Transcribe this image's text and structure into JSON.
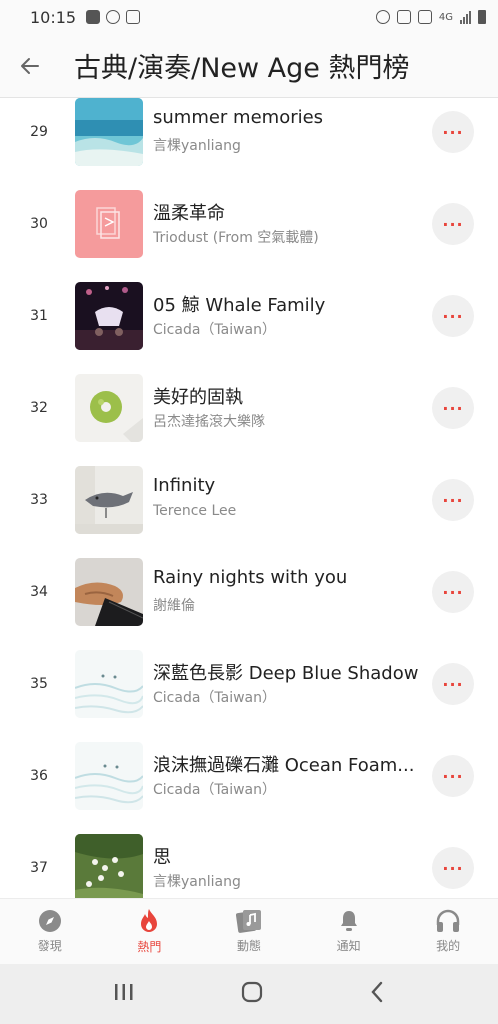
{
  "status_bar": {
    "time": "10:15",
    "network": "4G",
    "icons": [
      "calendar-icon",
      "do-not-disturb-icon",
      "image-icon",
      "alarm-icon",
      "mute-icon",
      "battery-saver-icon",
      "signal-icon",
      "battery-icon"
    ]
  },
  "header": {
    "title": "古典/演奏/New Age 熱門榜",
    "back_icon": "back-arrow-icon"
  },
  "songs": [
    {
      "rank": "29",
      "title": "summer memories",
      "artist": "言棵yanliang"
    },
    {
      "rank": "30",
      "title": "溫柔革命",
      "artist": "Triodust (From 空氣載體)"
    },
    {
      "rank": "31",
      "title": "05 鯨 Whale Family",
      "artist": "Cicada（Taiwan）"
    },
    {
      "rank": "32",
      "title": "美好的固執",
      "artist": "呂杰達搖滾大樂隊"
    },
    {
      "rank": "33",
      "title": "Infinity",
      "artist": "Terence Lee"
    },
    {
      "rank": "34",
      "title": "Rainy nights with you",
      "artist": "謝維倫"
    },
    {
      "rank": "35",
      "title": "深藍色長影 Deep Blue Shadow",
      "artist": "Cicada（Taiwan）"
    },
    {
      "rank": "36",
      "title": "浪沫撫過礫石灘 Ocean Foam...",
      "artist": "Cicada（Taiwan）"
    },
    {
      "rank": "37",
      "title": "思",
      "artist": "言棵yanliang"
    }
  ],
  "more_label": "···",
  "bottom_nav": {
    "items": [
      {
        "label": "發現",
        "icon": "compass-icon"
      },
      {
        "label": "熱門",
        "icon": "flame-icon",
        "active": true
      },
      {
        "label": "動態",
        "icon": "music-card-icon"
      },
      {
        "label": "通知",
        "icon": "bell-icon"
      },
      {
        "label": "我的",
        "icon": "headphones-icon"
      }
    ]
  },
  "colors": {
    "accent": "#e8453c",
    "text_primary": "#222222",
    "text_secondary": "#8a8a8a",
    "more_bg": "#f0f0f0"
  }
}
